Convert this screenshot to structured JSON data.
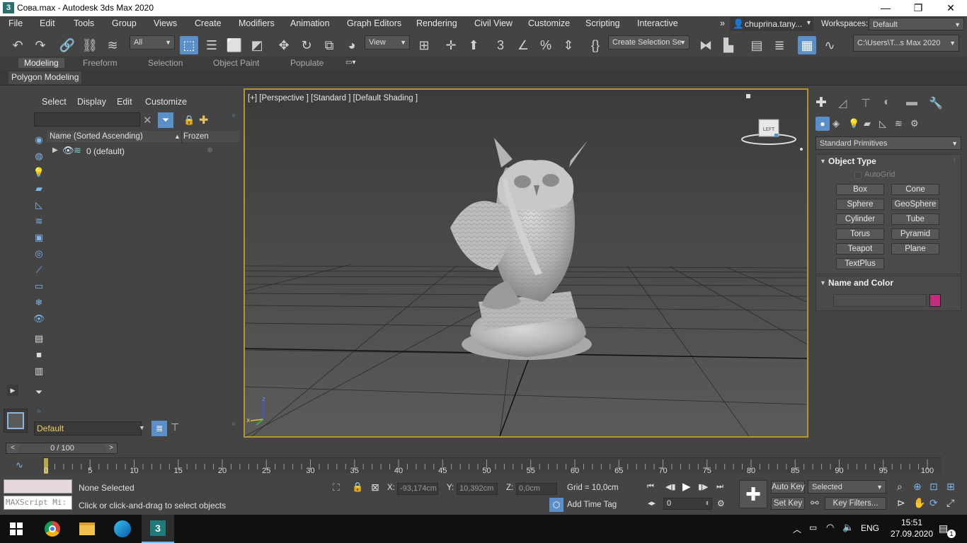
{
  "window": {
    "title": "Сова.max - Autodesk 3ds Max 2020",
    "app_icon": "3",
    "minimize": "—",
    "maximize": "❐",
    "close": "✕"
  },
  "menu": {
    "items": [
      "File",
      "Edit",
      "Tools",
      "Group",
      "Views",
      "Create",
      "Modifiers",
      "Animation",
      "Graph Editors",
      "Rendering",
      "Civil View",
      "Customize",
      "Scripting",
      "Interactive"
    ],
    "overflow": "»",
    "user": "chuprina.tany...",
    "workspaces_label": "Workspaces:",
    "workspace_value": "Default"
  },
  "toolbar": {
    "selection_filter": "All",
    "ref_coord": "View",
    "named_selection": "Create Selection Se",
    "project_path": "C:\\Users\\T...s Max 2020"
  },
  "ribbon": {
    "tabs": [
      "Modeling",
      "Freeform",
      "Selection",
      "Object Paint",
      "Populate"
    ],
    "active_tab": "Modeling",
    "panel_label": "Polygon Modeling"
  },
  "scene_explorer": {
    "menu": [
      "Select",
      "Display",
      "Edit",
      "Customize"
    ],
    "column_name": "Name (Sorted Ascending)",
    "sort_indicator": "▲",
    "column_frozen": "Frozen",
    "layer_row": "0 (default)",
    "layer_dropdown": "Default"
  },
  "viewport": {
    "label": "[+] [Perspective ] [Standard ] [Default Shading ]",
    "viewcube_face": "LEFT",
    "axis_z": "z",
    "axis_x": "x"
  },
  "command_panel": {
    "category": "Standard Primitives",
    "object_type_title": "Object Type",
    "autogrid": "AutoGrid",
    "buttons": [
      "Box",
      "Cone",
      "Sphere",
      "GeoSphere",
      "Cylinder",
      "Tube",
      "Torus",
      "Pyramid",
      "Teapot",
      "Plane",
      "TextPlus"
    ],
    "name_color_title": "Name and Color",
    "swatch_color": "#c0307a"
  },
  "timeline": {
    "frame_counter": "0 / 100",
    "prev": "<",
    "next": ">",
    "ticks": [
      "0",
      "5",
      "10",
      "15",
      "20",
      "25",
      "30",
      "35",
      "40",
      "45",
      "50",
      "55",
      "60",
      "65",
      "70",
      "75",
      "80",
      "85",
      "90",
      "95",
      "100"
    ]
  },
  "status": {
    "maxscript_placeholder": "MAXScript Mi:",
    "selection_status": "None Selected",
    "prompt": "Click or click-and-drag to select objects",
    "x_label": "X:",
    "x_value": "-93,174cm",
    "y_label": "Y:",
    "y_value": "10,392cm",
    "z_label": "Z:",
    "z_value": "0,0cm",
    "grid": "Grid = 10,0cm",
    "add_time_tag": "Add Time Tag",
    "auto_key": "Auto Key",
    "set_key": "Set Key",
    "key_mode": "Selected",
    "key_filters": "Key Filters...",
    "current_frame": "0"
  },
  "taskbar": {
    "language": "ENG",
    "time": "15:51",
    "date": "27.09.2020",
    "notification_count": "1",
    "max_icon": "3"
  }
}
